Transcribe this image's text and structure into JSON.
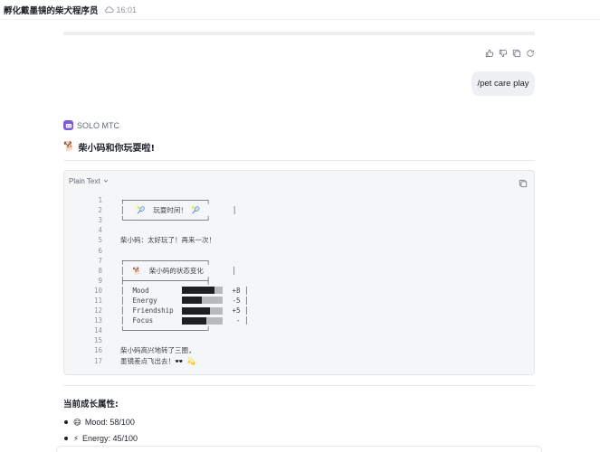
{
  "header": {
    "title": "孵化戴墨镜的柴犬程序员",
    "time": "16:01"
  },
  "user_message": "/pet care play",
  "bot": {
    "name": "SOLO MTC",
    "reply_emoji": "🐕",
    "reply_title": "柴小码和你玩耍啦!"
  },
  "code_block": {
    "language": "Plain Text",
    "lines": [
      "┌────────────────────┐",
      "│   🎾  玩耍时间！ 🎾        │",
      "└────────────────────┘",
      "",
      "柴小码：太好玩了！再来一次！",
      "",
      "┌────────────────────┐",
      "│  🐕  柴小码的状态变化       │",
      "├────────────────────┤",
      "",
      "",
      "",
      "",
      "└────────────────────┘",
      "",
      "柴小码高兴地转了三圈,",
      "墨镜差点飞出去！🕶️ 💫"
    ],
    "stats": [
      {
        "line": 10,
        "label": "Mood",
        "fill": 0.8,
        "value": "+8"
      },
      {
        "line": 11,
        "label": "Energy",
        "fill": 0.5,
        "value": "-5"
      },
      {
        "line": 12,
        "label": "Friendship",
        "fill": 0.7,
        "value": "+5"
      },
      {
        "line": 13,
        "label": "Focus",
        "fill": 0.6,
        "value": "-"
      }
    ]
  },
  "attributes": {
    "title": "当前成长属性:",
    "items": [
      {
        "emoji": "😄",
        "text": "Mood: 58/100"
      },
      {
        "emoji": "⚡",
        "text": "Energy: 45/100"
      }
    ]
  },
  "icons": {
    "cloud": "cloud-icon",
    "thumbs_up": "thumbs-up-icon",
    "thumbs_down": "thumbs-down-icon",
    "copy": "copy-icon",
    "refresh": "refresh-icon",
    "chevron": "chevron-down-icon"
  },
  "colors": {
    "bot_accent": "#7c5cd6",
    "bubble_bg": "#eef0f3",
    "code_bg": "#f5f6f7"
  }
}
